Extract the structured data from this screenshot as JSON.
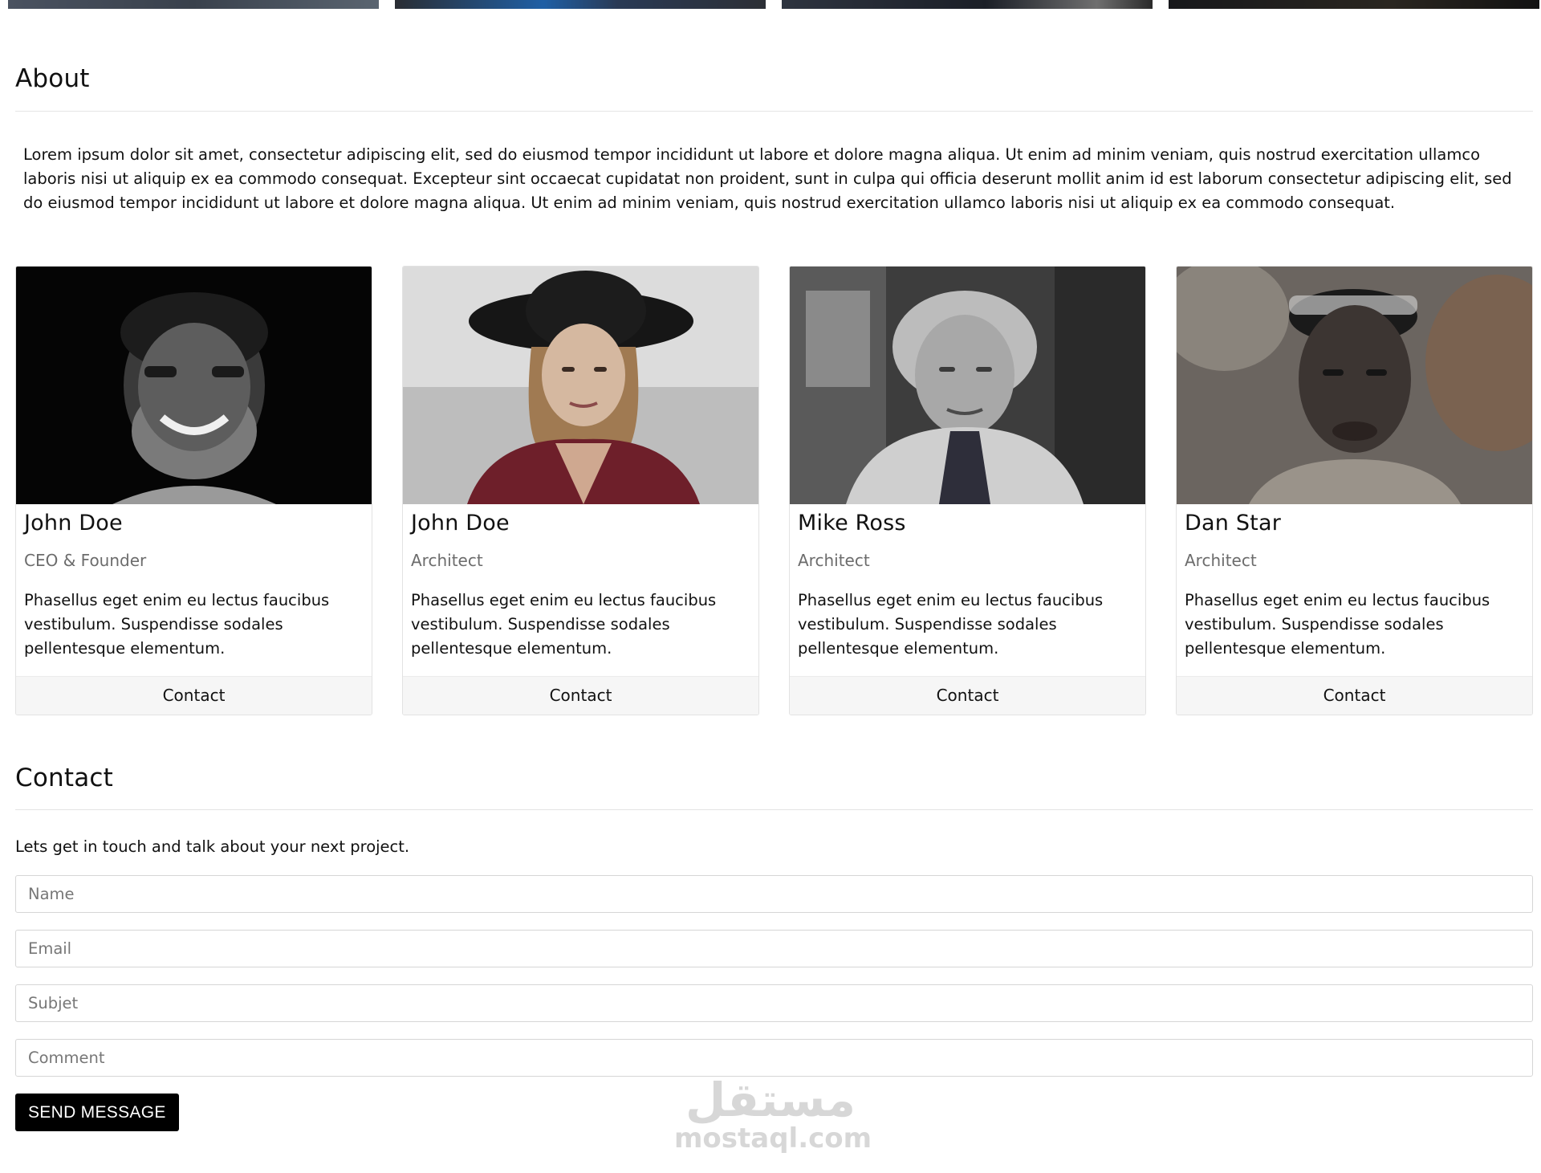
{
  "about": {
    "title": "About",
    "text": "Lorem ipsum dolor sit amet, consectetur adipiscing elit, sed do eiusmod tempor incididunt ut labore et dolore magna aliqua. Ut enim ad minim veniam, quis nostrud exercitation ullamco laboris nisi ut aliquip ex ea commodo consequat. Excepteur sint occaecat cupidatat non proident, sunt in culpa qui officia deserunt mollit anim id est laborum consectetur adipiscing elit, sed do eiusmod tempor incididunt ut labore et dolore magna aliqua. Ut enim ad minim veniam, quis nostrud exercitation ullamco laboris nisi ut aliquip ex ea commodo consequat."
  },
  "team": [
    {
      "name": "John Doe",
      "role": "CEO & Founder",
      "description": "Phasellus eget enim eu lectus faucibus vestibulum. Suspendisse sodales pellentesque elementum.",
      "contact_label": "Contact"
    },
    {
      "name": "John Doe",
      "role": "Architect",
      "description": "Phasellus eget enim eu lectus faucibus vestibulum. Suspendisse sodales pellentesque elementum.",
      "contact_label": "Contact"
    },
    {
      "name": "Mike Ross",
      "role": "Architect",
      "description": "Phasellus eget enim eu lectus faucibus vestibulum. Suspendisse sodales pellentesque elementum.",
      "contact_label": "Contact"
    },
    {
      "name": "Dan Star",
      "role": "Architect",
      "description": "Phasellus eget enim eu lectus faucibus vestibulum. Suspendisse sodales pellentesque elementum.",
      "contact_label": "Contact"
    }
  ],
  "contact": {
    "title": "Contact",
    "text": "Lets get in touch and talk about your next project.",
    "fields": {
      "name_placeholder": "Name",
      "email_placeholder": "Email",
      "subject_placeholder": "Subjet",
      "comment_placeholder": "Comment"
    },
    "send_label": "SEND MESSAGE"
  },
  "watermark": {
    "arabic": "مستقل",
    "latin": "mostaql.com"
  },
  "colors": {
    "button_bg": "#000000",
    "button_text": "#ffffff",
    "muted_text": "#6c6c6c",
    "card_footer_bg": "#f6f6f6"
  }
}
